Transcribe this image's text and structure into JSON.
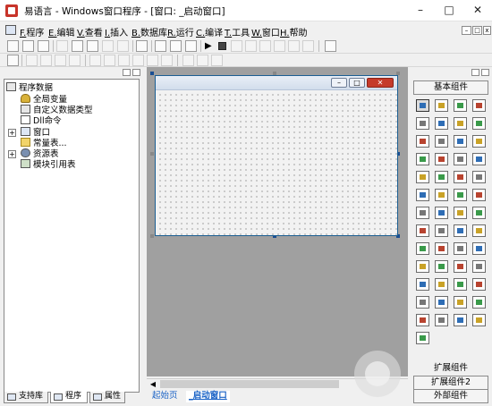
{
  "window": {
    "title": "易语言 - Windows窗口程序 - [窗口: _启动窗口]",
    "minimize": "–",
    "maximize": "□",
    "close": "✕"
  },
  "menu": [
    "F.程序",
    "E.编辑",
    "V.查看",
    "I.插入",
    "B.数据库",
    "R.运行",
    "C.编译",
    "T.工具",
    "W.窗口",
    "H.帮助"
  ],
  "tree": {
    "root": "程序数据",
    "items": [
      "全局变量",
      "自定义数据类型",
      "Dll命令",
      "窗口",
      "常量表...",
      "资源表",
      "模块引用表"
    ]
  },
  "left_tabs": [
    "支持库",
    "程序",
    "属性"
  ],
  "doc_tabs": [
    "起始页",
    "_启动窗口"
  ],
  "right": {
    "header": "基本组件",
    "extended": "扩展组件",
    "extended2": "扩展组件2",
    "external": "外部组件",
    "ext_label": "扩展组件"
  },
  "icons": {
    "app": "app-logo-icon",
    "toolbox": "component-icon"
  },
  "colors": {
    "form_border": "#1c5f93",
    "design_bg": "#a0a0a0",
    "close_btn": "#c53a2a"
  }
}
